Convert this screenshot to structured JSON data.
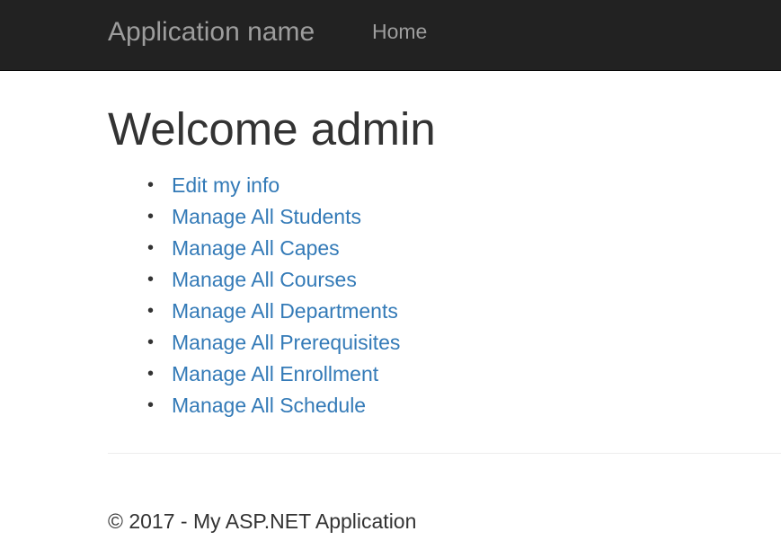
{
  "navbar": {
    "brand": "Application name",
    "links": [
      {
        "label": "Home"
      }
    ]
  },
  "main": {
    "title": "Welcome admin",
    "menu": [
      {
        "label": "Edit my info"
      },
      {
        "label": "Manage All Students"
      },
      {
        "label": "Manage All Capes"
      },
      {
        "label": "Manage All Courses"
      },
      {
        "label": "Manage All Departments"
      },
      {
        "label": "Manage All Prerequisites"
      },
      {
        "label": "Manage All Enrollment"
      },
      {
        "label": "Manage All Schedule"
      }
    ]
  },
  "footer": {
    "text": "© 2017 - My ASP.NET Application"
  },
  "colors": {
    "navbar_bg": "#222222",
    "navbar_text": "#9d9d9d",
    "link": "#337ab7",
    "text": "#333333"
  }
}
